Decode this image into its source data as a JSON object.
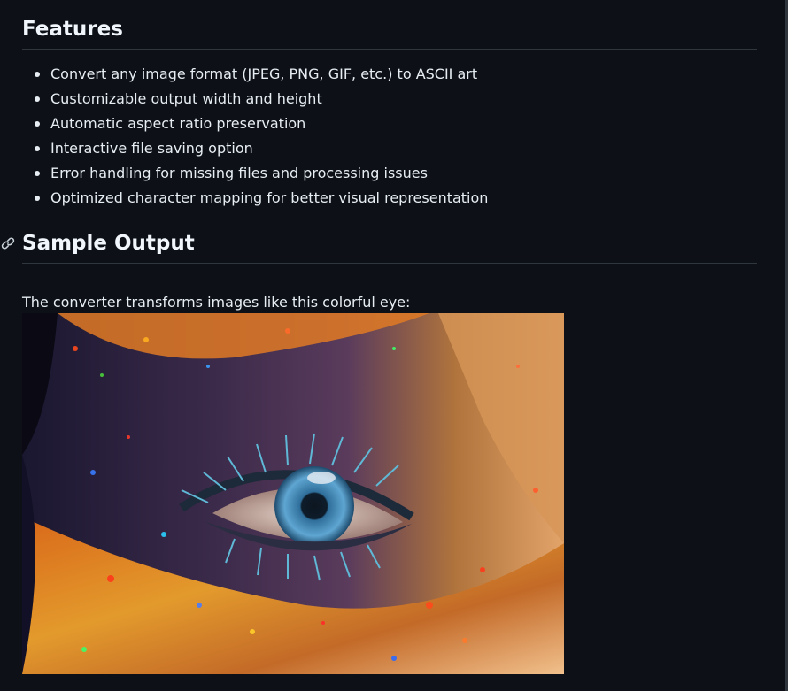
{
  "features": {
    "heading": "Features",
    "items": [
      "Convert any image format (JPEG, PNG, GIF, etc.) to ASCII art",
      "Customizable output width and height",
      "Automatic aspect ratio preservation",
      "Interactive file saving option",
      "Error handling for missing files and processing issues",
      "Optimized character mapping for better visual representation"
    ]
  },
  "sample_output": {
    "heading": "Sample Output",
    "intro": "The converter transforms images like this colorful eye:",
    "anchor_icon": "link-icon",
    "image_icon": "colorful-eye-image"
  },
  "colors": {
    "background": "#0d1117",
    "text": "#e6edf3",
    "heading": "#f0f6fc",
    "rule": "#30363d"
  }
}
